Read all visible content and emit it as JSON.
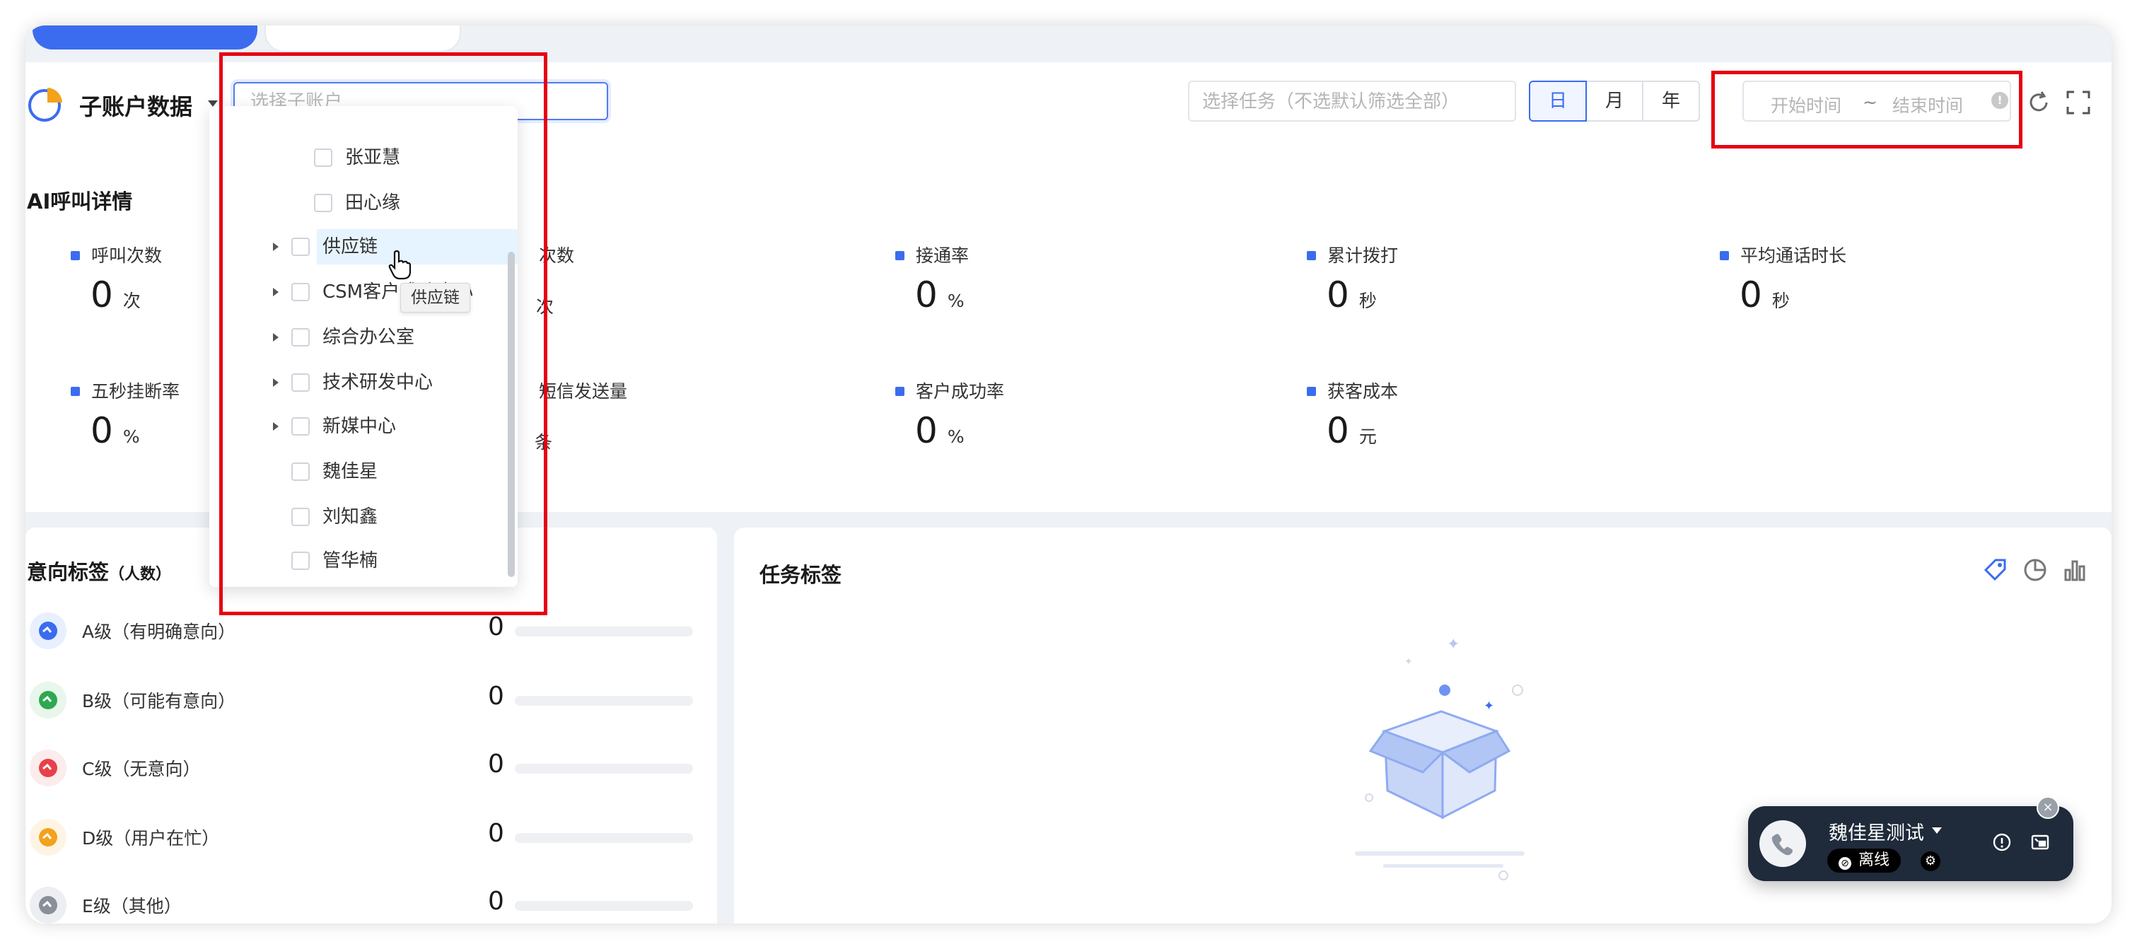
{
  "header": {
    "title": "子账户数据",
    "sub_account_placeholder": "选择子账户",
    "task_placeholder": "选择任务（不选默认筛选全部）",
    "periods": [
      "日",
      "月",
      "年"
    ],
    "active_period": "日",
    "start_placeholder": "开始时间",
    "range_sep": "~",
    "end_placeholder": "结束时间",
    "info_glyph": "!"
  },
  "ai_call": {
    "title": "AI呼叫详情",
    "metrics_row1": [
      {
        "label": "呼叫次数",
        "value": "0",
        "unit": "次"
      },
      {
        "label": "次数",
        "value": "",
        "unit": "次"
      },
      {
        "label": "接通率",
        "value": "0",
        "unit": "%"
      },
      {
        "label": "累计拨打",
        "value": "0",
        "unit": "秒"
      },
      {
        "label": "平均通话时长",
        "value": "0",
        "unit": "秒"
      }
    ],
    "metrics_row2": [
      {
        "label": "五秒挂断率",
        "value": "0",
        "unit": "%"
      },
      {
        "label": "短信发送量",
        "value": "",
        "unit": "条"
      },
      {
        "label": "客户成功率",
        "value": "0",
        "unit": "%"
      },
      {
        "label": "获客成本",
        "value": "0",
        "unit": "元"
      }
    ]
  },
  "intent": {
    "title": "意向标签",
    "title_suffix": "（人数）",
    "rows": [
      {
        "label": "A级（有明确意向）",
        "count": "0",
        "color": "#3b6cf0"
      },
      {
        "label": "B级（可能有意向）",
        "count": "0",
        "color": "#2fa84f"
      },
      {
        "label": "C级（无意向）",
        "count": "0",
        "color": "#e8404b"
      },
      {
        "label": "D级（用户在忙）",
        "count": "0",
        "color": "#f3a21b"
      },
      {
        "label": "E级（其他）",
        "count": "0",
        "color": "#8a909a"
      }
    ]
  },
  "task_tags": {
    "title": "任务标签"
  },
  "dropdown": {
    "items": [
      {
        "label": "张亚慧",
        "level": 2,
        "expandable": false
      },
      {
        "label": "田心缘",
        "level": 2,
        "expandable": false
      },
      {
        "label": "供应链",
        "level": 1,
        "expandable": true,
        "hovered": true
      },
      {
        "label": "CSM客户成功中心",
        "level": 1,
        "expandable": true
      },
      {
        "label": "综合办公室",
        "level": 1,
        "expandable": true
      },
      {
        "label": "技术研发中心",
        "level": 1,
        "expandable": true
      },
      {
        "label": "新媒中心",
        "level": 1,
        "expandable": true
      },
      {
        "label": "魏佳星",
        "level": 1,
        "expandable": false
      },
      {
        "label": "刘知鑫",
        "level": 1,
        "expandable": false
      },
      {
        "label": "管华楠",
        "level": 1,
        "expandable": false
      }
    ],
    "tooltip": "供应链"
  },
  "call_widget": {
    "name": "魏佳星测试",
    "status": "离线",
    "close_glyph": "×"
  },
  "colors": {
    "primary": "#3b6cf0",
    "highlight_red": "#e60012",
    "hover_bg": "#e6f4ff"
  }
}
